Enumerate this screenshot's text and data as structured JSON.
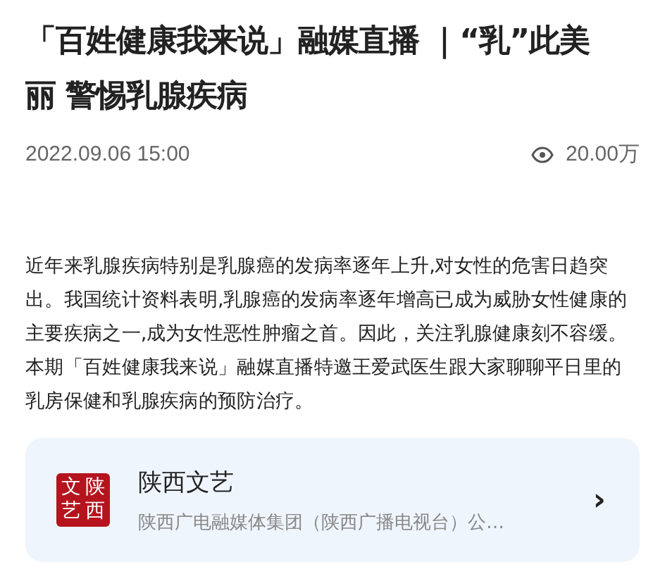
{
  "article": {
    "title": "「百姓健康我来说」融媒直播 ｜“乳”此美丽 警惕乳腺疾病",
    "date": "2022.09.06 15:00",
    "views": "20.00万",
    "body": "近年来乳腺疾病特别是乳腺癌的发病率逐年上升,对女性的危害日趋突出。我国统计资料表明,乳腺癌的发病率逐年增高已成为威胁女性健康的主要疾病之一,成为女性恶性肿瘤之首。因此，关注乳腺健康刻不容缓。本期「百姓健康我来说」融媒直播特邀王爱武医生跟大家聊聊平日里的乳房保健和乳腺疾病的预防治疗。"
  },
  "source_card": {
    "logo_chars": [
      "文",
      "陕",
      "艺",
      "西"
    ],
    "name": "陕西文艺",
    "description": "陕西广电融媒体集团（陕西广播电视台）公…",
    "arrow": "›"
  }
}
